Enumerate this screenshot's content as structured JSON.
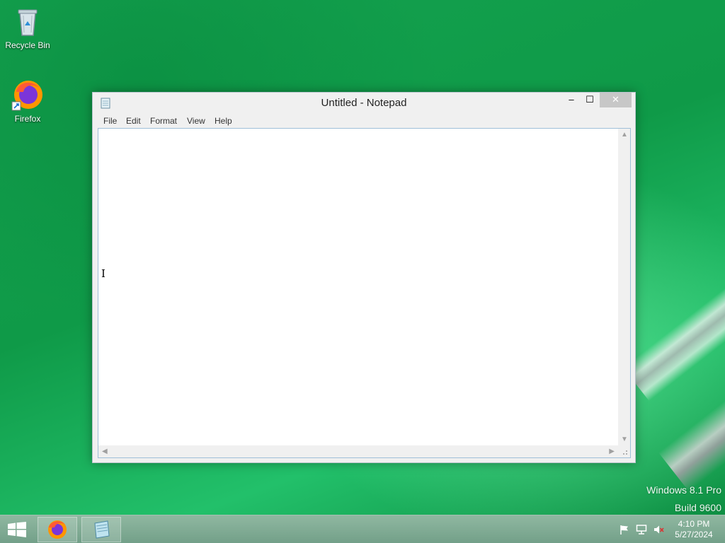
{
  "desktop": {
    "icons": [
      {
        "label": "Recycle Bin",
        "icon": "recycle-bin-icon"
      },
      {
        "label": "Firefox",
        "icon": "firefox-icon"
      }
    ],
    "watermark": {
      "line1": "Windows 8.1 Pro",
      "line2": "Build 9600"
    }
  },
  "window": {
    "title": "Untitled - Notepad",
    "buttons": {
      "minimize": "–",
      "maximize": "☐",
      "close": "✕"
    },
    "menu": [
      "File",
      "Edit",
      "Format",
      "View",
      "Help"
    ],
    "content": ""
  },
  "taskbar": {
    "apps": [
      {
        "name": "Firefox",
        "icon": "firefox-icon"
      },
      {
        "name": "Notepad",
        "icon": "notepad-icon"
      }
    ],
    "clock": {
      "time": "4:10 PM",
      "date": "5/27/2024"
    }
  },
  "colors": {
    "desktop": "#0f9a48",
    "accent_close": "#c7c7c7",
    "editor_border": "#9fbfd8"
  }
}
